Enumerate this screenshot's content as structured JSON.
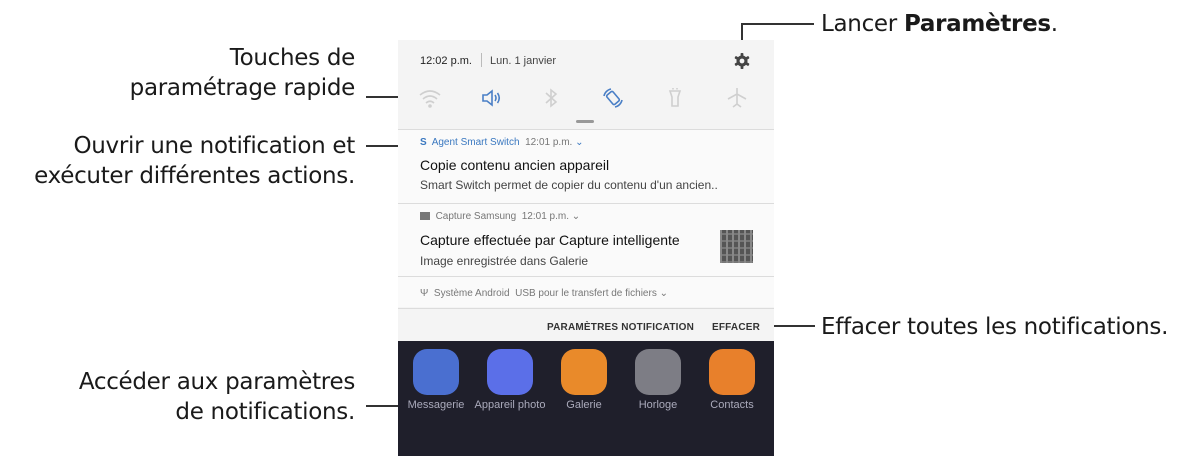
{
  "callouts": {
    "quick_settings": [
      "Touches de",
      "paramétrage rapide"
    ],
    "open_notification": [
      "Ouvrir une notification et",
      "exécuter différentes actions."
    ],
    "notification_settings": [
      "Accéder aux paramètres",
      "de notifications."
    ],
    "launch_settings_prefix": "Lancer ",
    "launch_settings_bold": "Paramètres",
    "launch_settings_suffix": ".",
    "clear_all": "Effacer toutes les notifications."
  },
  "status": {
    "time": "12:02 p.m.",
    "date": "Lun. 1 janvier"
  },
  "quick_settings": [
    "wifi-icon",
    "sound-icon",
    "bluetooth-icon",
    "auto-rotate-icon",
    "flashlight-icon",
    "airplane-icon"
  ],
  "notifications": [
    {
      "app": "Agent Smart Switch",
      "time": "12:01 p.m.",
      "title": "Copie contenu ancien appareil",
      "text": "Smart Switch permet de copier du contenu d'un ancien.."
    },
    {
      "app": "Capture Samsung",
      "time": "12:01 p.m.",
      "title": "Capture effectuée par Capture intelligente",
      "text": "Image enregistrée dans Galerie"
    },
    {
      "app": "Système Android",
      "text": "USB pour le transfert de fichiers"
    }
  ],
  "actions": {
    "settings": "PARAMÈTRES NOTIFICATION",
    "clear": "EFFACER"
  },
  "apps": [
    {
      "label": "Messagerie",
      "color": "#4a6fd0"
    },
    {
      "label": "Appareil photo",
      "color": "#5b6fe8"
    },
    {
      "label": "Galerie",
      "color": "#e98a2a"
    },
    {
      "label": "Horloge",
      "color": "#7d7d85"
    },
    {
      "label": "Contacts",
      "color": "#e8802b"
    }
  ],
  "colors": {
    "accent": "#3a78c0",
    "panel": "#f4f4f4",
    "home_bg": "#1f1f2b"
  }
}
